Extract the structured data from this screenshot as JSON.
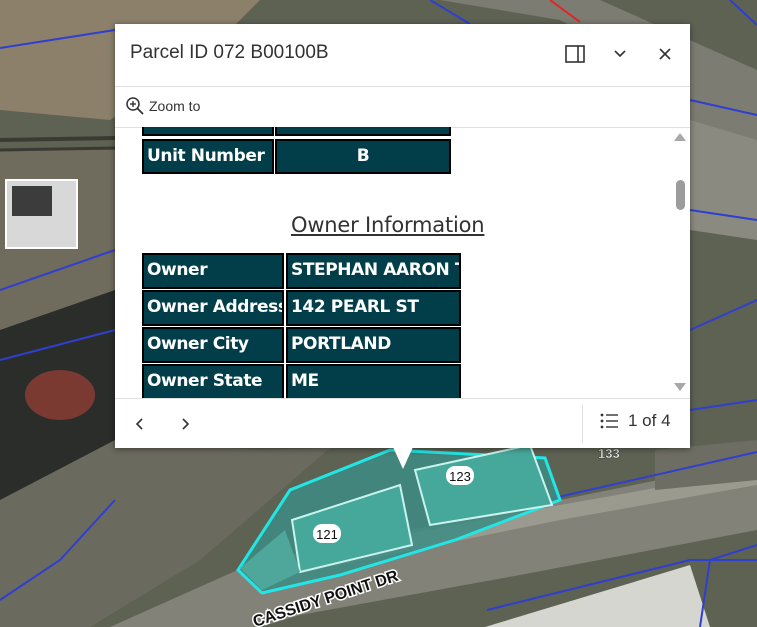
{
  "popup": {
    "title": "Parcel ID 072 B00100B",
    "zoom_label": "Zoom to",
    "partial_row": [
      "",
      ""
    ],
    "unit_row": {
      "label": "Unit Number",
      "value": "B"
    },
    "section_title": "Owner Information",
    "owner_rows": [
      {
        "label": "Owner",
        "value": "STEPHAN AARON T"
      },
      {
        "label": "Owner Address",
        "value": "142 PEARL ST"
      },
      {
        "label": "Owner City",
        "value": "PORTLAND"
      },
      {
        "label": "Owner State",
        "value": "ME"
      }
    ],
    "pager_text": "1 of 4",
    "icons": [
      "dock-icon",
      "collapse-icon",
      "close-icon",
      "zoom-in-icon",
      "prev-icon",
      "next-icon",
      "feature-list-icon"
    ]
  },
  "map": {
    "labels": [
      "123",
      "121",
      "133",
      "CASSIDY POINT DR"
    ],
    "parcel_line_color": "#2f3fcf",
    "selected_parcel_color": "#22e6e6",
    "road_color": "#7f8078",
    "building_color": "#3aa89a"
  }
}
